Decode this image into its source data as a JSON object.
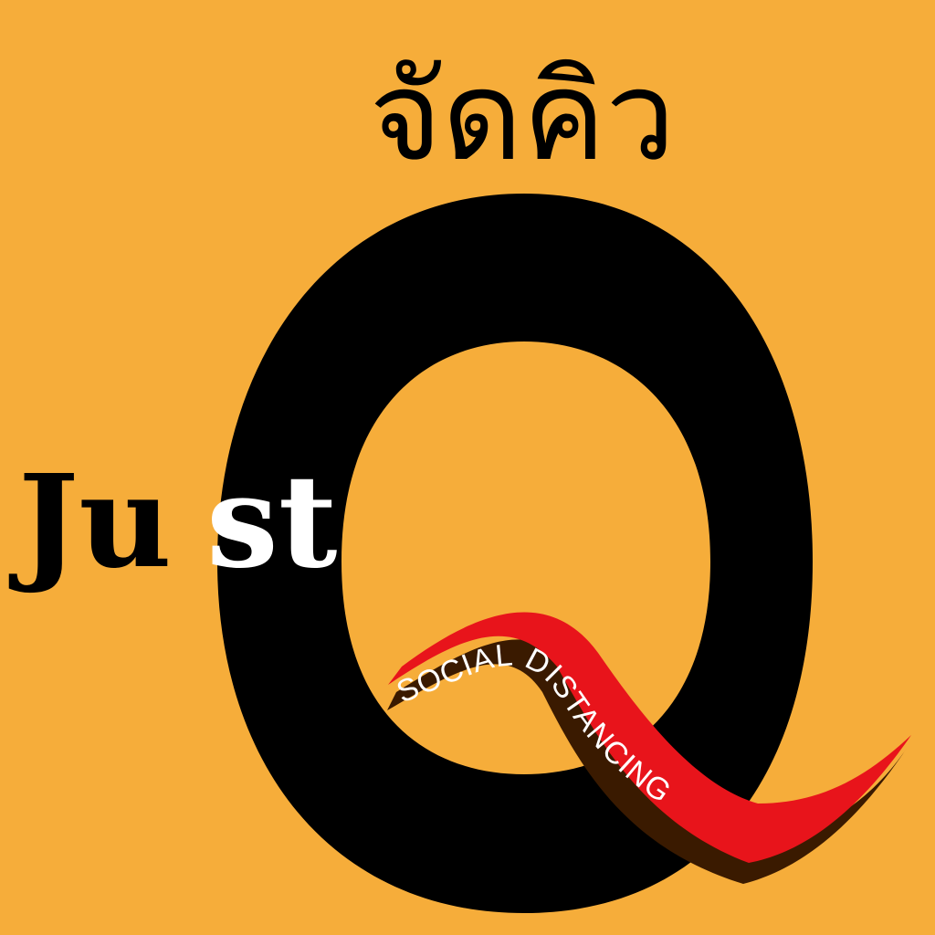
{
  "logo": {
    "thai_title": "จัดคิว",
    "word_just_dark": "Ju",
    "word_just_light": "st",
    "letter_q": "Q",
    "ribbon_text": "SOCIAL DISTANCING"
  },
  "colors": {
    "background": "#f6ad3a",
    "letter": "#000000",
    "ribbon": "#e8141b",
    "ribbon_shadow": "#3a1a00",
    "highlight_text": "#ffffff"
  }
}
